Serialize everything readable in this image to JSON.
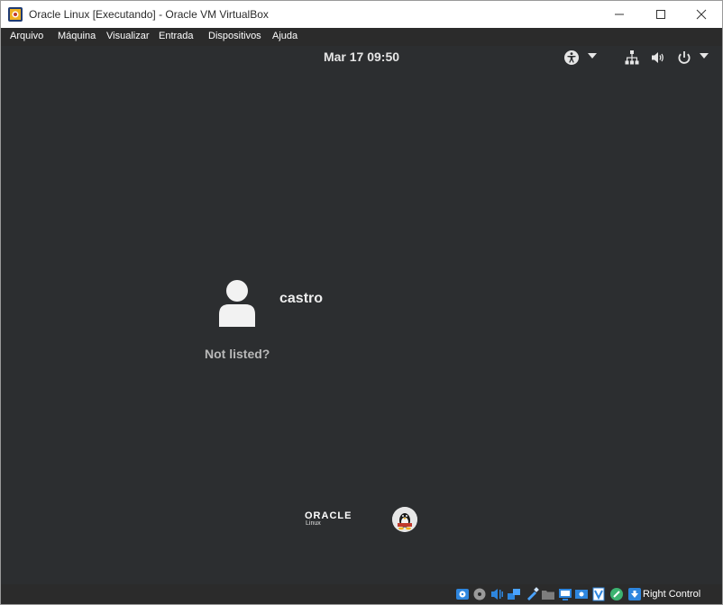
{
  "window": {
    "title": "Oracle Linux [Executando] - Oracle VM VirtualBox",
    "controls": [
      "minimize-icon",
      "maximize-icon",
      "close-icon"
    ]
  },
  "menubar": {
    "items": [
      "Arquivo",
      "Máquina",
      "Visualizar",
      "Entrada",
      "Dispositivos",
      "Ajuda"
    ]
  },
  "guest": {
    "clock": "Mar 17  09:50",
    "topbar_icons": [
      "accessibility-icon",
      "chevron-down-icon",
      "network-icon",
      "volume-icon",
      "power-icon",
      "chevron-down-icon"
    ],
    "user": {
      "name": "castro"
    },
    "not_listed": "Not listed?",
    "logo": {
      "word": "ORACLE",
      "sub": "Linux"
    }
  },
  "statusbar": {
    "icons": [
      "hard-disk-icon",
      "optical-drive-icon",
      "audio-icon",
      "network-adapter-icon",
      "usb-icon",
      "shared-folders-icon",
      "display-icon",
      "video-capture-icon",
      "virtualization-icon",
      "mouse-integration-icon",
      "host-key-icon"
    ],
    "host_key": "Right Control"
  },
  "colors": {
    "guest_background": "#2c2e30",
    "menubar_background": "#2b2b2b",
    "text_light": "#ededed"
  }
}
